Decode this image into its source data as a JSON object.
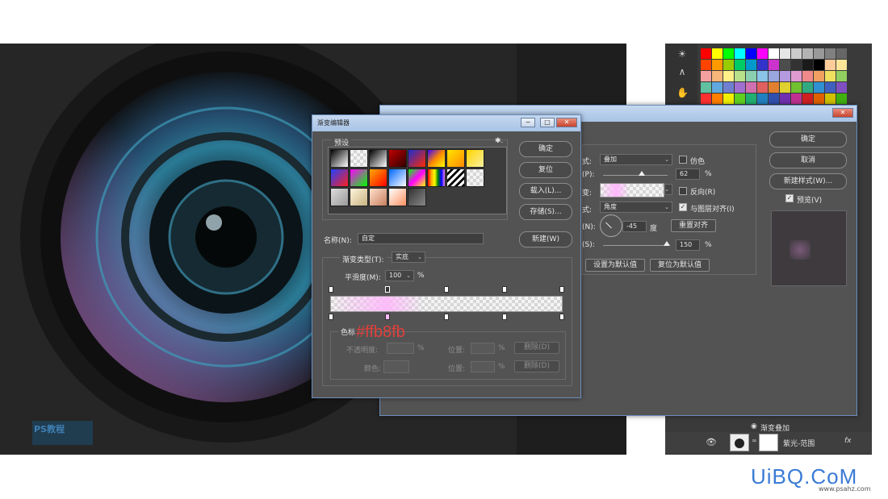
{
  "swatches": [
    "#ff0000",
    "#ffff00",
    "#00ff00",
    "#00ffff",
    "#0000ff",
    "#ff00ff",
    "#ffffff",
    "#e6e6e6",
    "#cccccc",
    "#b3b3b3",
    "#999999",
    "#808080",
    "#666666",
    "#ff4400",
    "#ff9900",
    "#99cc00",
    "#00cc66",
    "#0099cc",
    "#3333cc",
    "#cc33cc",
    "#4d4d4d",
    "#333333",
    "#1a1a1a",
    "#000000",
    "#ffcc99",
    "#ffe699",
    "#f4a0a0",
    "#f7b77a",
    "#fff08a",
    "#b8e08a",
    "#8ad0b0",
    "#8ac4e6",
    "#9aa6e0",
    "#b59ae0",
    "#e09ad0",
    "#f08a8a",
    "#f0a060",
    "#f0e060",
    "#90d060",
    "#60c0a0",
    "#60a8e0",
    "#7080d0",
    "#a070d0",
    "#d070b0",
    "#e06060",
    "#e08030",
    "#e0d030",
    "#70c030",
    "#30a880",
    "#3090d0",
    "#4060c0",
    "#8050c0",
    "#ff3030",
    "#ff7f00",
    "#f0f000",
    "#60d020",
    "#20b070",
    "#2080c0",
    "#3050b0",
    "#7030b0",
    "#c03090",
    "#d02020",
    "#e06000",
    "#d0c000",
    "#40b010"
  ],
  "tools": [
    "☀",
    "∧",
    "✋"
  ],
  "gradient_editor": {
    "title": "渐变编辑器",
    "presets_label": "预设",
    "gear": "✱.",
    "ok": "确定",
    "reset": "复位",
    "load": "载入(L)...",
    "save": "存储(S)...",
    "name_label": "名称(N):",
    "name_value": "自定",
    "new_button": "新建(W)",
    "type_label": "渐变类型(T):",
    "type_value": "实底",
    "smooth_label": "平滑度(M):",
    "smooth_value": "100",
    "percent": "%",
    "stops_label": "色标",
    "opacity_label": "不透明度:",
    "location_label": "位置:",
    "delete_label": "删除(D)",
    "color_label": "颜色:",
    "annotation": "#ffb8fb",
    "presets": [
      "linear-gradient(135deg,#000,#fff)",
      "checker",
      "linear-gradient(135deg,#000,#fff)",
      "linear-gradient(135deg,#c00000,#300000)",
      "linear-gradient(135deg,#1d2cd0,#ff2a00)",
      "linear-gradient(135deg,#3a00ff,#ff8800,#ffff00)",
      "linear-gradient(135deg,#ffe600,#ff8800)",
      "linear-gradient(135deg,#ffd400,#f8f0a0)",
      "linear-gradient(135deg,#2040ff,#ff2020)",
      "linear-gradient(135deg,#ff00ff,#00ff00)",
      "linear-gradient(135deg,#ffaa00,#ff0000)",
      "linear-gradient(135deg,#0066ff,#ffffff)",
      "linear-gradient(135deg,#00ff00,#ff00ff,#ffff00)",
      "linear-gradient(90deg,red,orange,yellow,green,blue,violet)",
      "repeating-linear-gradient(135deg,#fff 0 3px,#000 3px 6px)",
      "checker",
      "linear-gradient(135deg,#ddd,#999)",
      "linear-gradient(135deg,#fff5dd,#c8b480)",
      "linear-gradient(135deg,#ffe0cc,#c88060)",
      "linear-gradient(135deg,#fff,#ff9060)",
      "linear-gradient(135deg,#333,#888)"
    ]
  },
  "layer_style": {
    "ok": "确定",
    "cancel": "取消",
    "new_style": "新建样式(W)...",
    "preview": "预览(V)",
    "blend_label": "式:",
    "blend_value": "叠加",
    "dither": "仿色",
    "opacity_label": "(P):",
    "opacity_value": "62",
    "gradient_label": "变:",
    "reverse": "反向(R)",
    "style_label": "式:",
    "style_value": "角度",
    "align": "与图层对齐(I)",
    "angle_label": "(N):",
    "angle_value": "-45",
    "degree": "度",
    "reset_align": "重置对齐",
    "scale_label": "(S):",
    "scale_value": "150",
    "percent": "%",
    "set_default": "设置为默认值",
    "reset_default": "复位为默认值"
  },
  "layers": {
    "effect_name": "渐变叠加",
    "layer_name": "紫光-范围",
    "fx": "fx"
  },
  "watermark": {
    "brand": "UiBQ.CoM",
    "url": "www.psahz.com",
    "logo_text": "PS教程"
  }
}
